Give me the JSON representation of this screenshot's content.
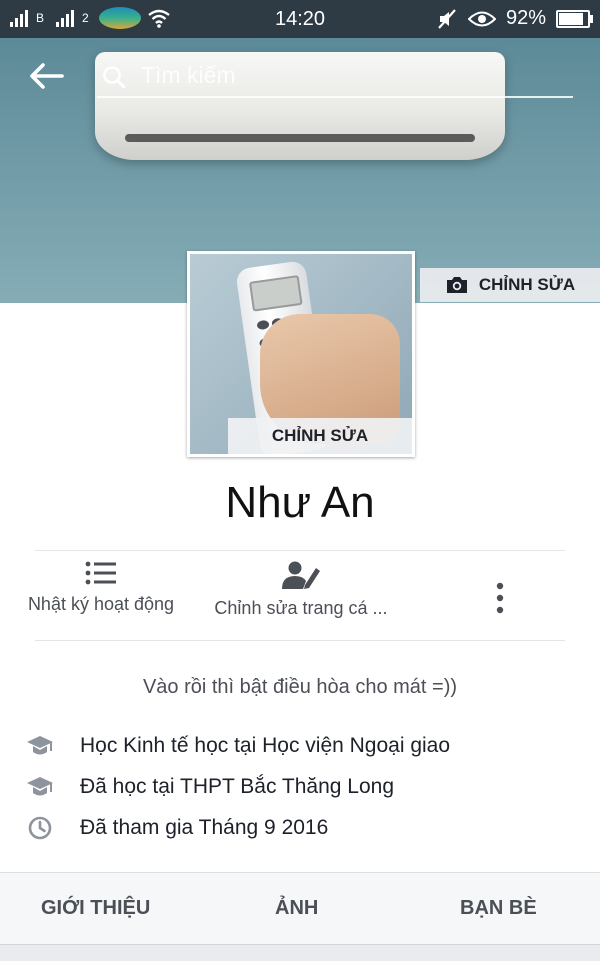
{
  "status_bar": {
    "time": "14:20",
    "battery": "92%",
    "battery_level": 0.92,
    "sim_labels": [
      "B",
      "2"
    ]
  },
  "search": {
    "placeholder": "Tìm kiếm"
  },
  "cover": {
    "edit_label": "CHỈNH SỬA"
  },
  "avatar": {
    "edit_label": "CHỈNH SỬA"
  },
  "profile": {
    "name": "Như An"
  },
  "actions": {
    "activity_log": "Nhật ký hoạt động",
    "edit_profile": "Chỉnh sửa trang cá ..."
  },
  "bio": "Vào rồi thì bật điều hòa cho mát =))",
  "intro": {
    "items": [
      {
        "icon": "graduation-cap-icon",
        "text": "Học Kinh tế học tại Học viện Ngoại giao"
      },
      {
        "icon": "graduation-cap-icon",
        "text": "Đã học tại THPT Bắc Thăng Long"
      },
      {
        "icon": "clock-icon",
        "text": "Đã tham gia Tháng 9 2016"
      }
    ]
  },
  "tabs": [
    "GIỚI THIỆU",
    "ẢNH",
    "BẠN BÈ"
  ],
  "colors": {
    "status_bar_bg": "#2e3b44",
    "cover_bg": "#6f9aa6",
    "text_primary": "#1d2129",
    "text_secondary": "#4b4f56",
    "tab_bar_bg": "#f6f7f9"
  }
}
